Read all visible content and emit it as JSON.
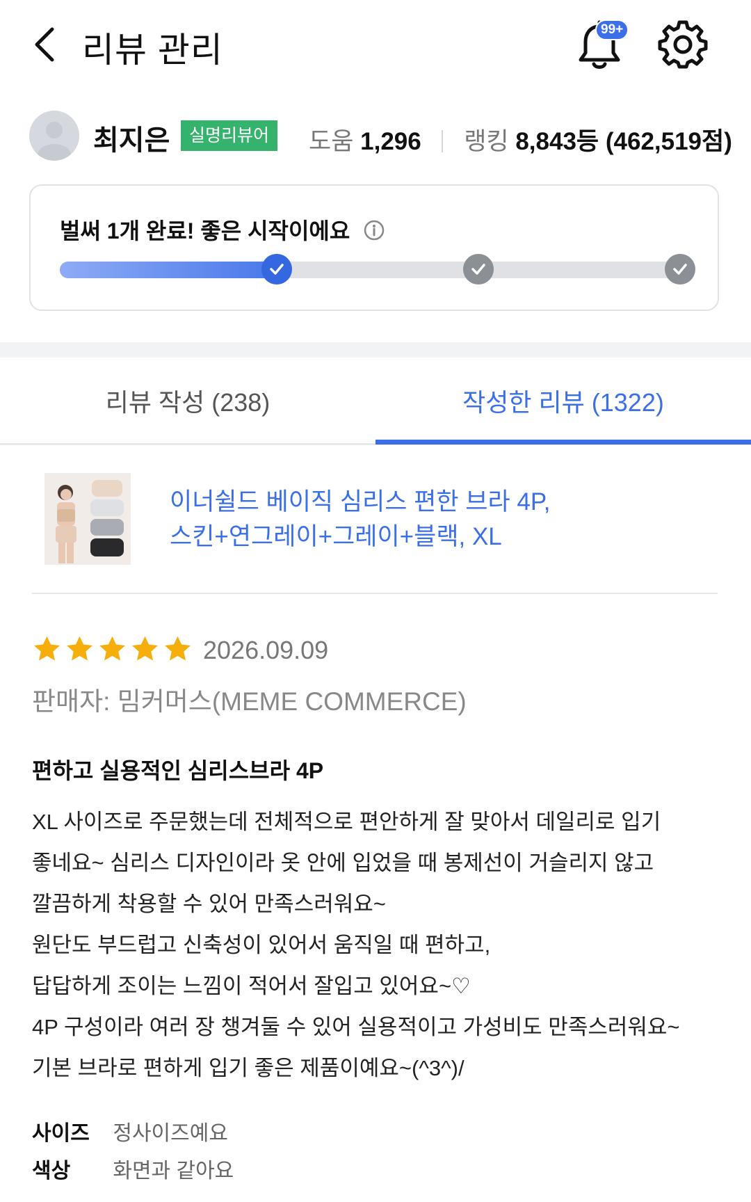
{
  "header": {
    "title": "리뷰 관리",
    "notification_badge": "99+",
    "accent_color": "#3a6fe8"
  },
  "profile": {
    "name": "최지은",
    "badge": "실명리뷰어",
    "help_label": "도움",
    "help_count": "1,296",
    "ranking_label": "랭킹",
    "ranking_value": "8,843등 (462,519점)"
  },
  "progress": {
    "title": "벌써 1개 완료! 좋은 시작이에요",
    "completed_steps": 1,
    "total_steps": 3,
    "fill_fraction": 0.34
  },
  "tabs": [
    {
      "label": "리뷰 작성 (238)",
      "active": false
    },
    {
      "label": "작성한 리뷰 (1322)",
      "active": true
    }
  ],
  "product": {
    "name_line1": "이너쉴드 베이직 심리스 편한 브라 4P,",
    "name_line2": "스킨+연그레이+그레이+블랙, XL"
  },
  "review": {
    "rating": 5,
    "max_rating": 5,
    "date": "2026.09.09",
    "seller": "판매자: 밈커머스(MEME COMMERCE)",
    "title": "편하고 실용적인 심리스브라 4P",
    "body_lines": [
      "XL 사이즈로 주문했는데 전체적으로 편안하게 잘 맞아서 데일리로 입기",
      "좋네요~ 심리스 디자인이라 옷 안에 입었을 때 봉제선이 거슬리지 않고",
      "깔끔하게 착용할 수 있어 만족스러워요~",
      "원단도 부드럽고 신축성이 있어서 움직일 때 편하고,",
      "답답하게 조이는 느낌이 적어서 잘입고 있어요~♡",
      "4P 구성이라 여러 장 챙겨둘 수 있어 실용적이고 가성비도 만족스러워요~",
      "기본 브라로 편하게 입기 좋은 제품이예요~(^3^)/"
    ],
    "attributes": [
      {
        "key": "사이즈",
        "value": "정사이즈예요"
      },
      {
        "key": "색상",
        "value": "화면과 같아요"
      }
    ]
  }
}
